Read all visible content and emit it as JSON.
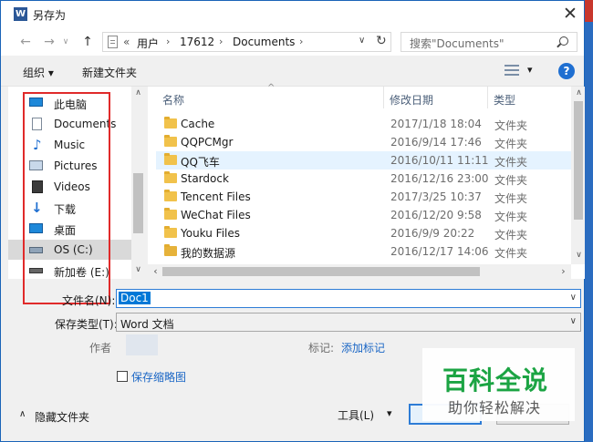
{
  "window": {
    "title": "另存为",
    "app_icon_letter": "W",
    "close_glyph": "✕"
  },
  "address": {
    "back_glyph": "←",
    "forward_glyph": "→",
    "up_glyph": "↑",
    "overflow": "«",
    "crumbs": [
      "用户",
      "17612",
      "Documents"
    ],
    "separator": "›",
    "dropdown_glyph": "∨",
    "refresh_glyph": "↻"
  },
  "search": {
    "placeholder": "搜索\"Documents\""
  },
  "toolbar": {
    "organize": "组织 ▾",
    "new_folder": "新建文件夹",
    "view_dropdown": "▾",
    "help": "?"
  },
  "nav": {
    "items": [
      {
        "label": "此电脑",
        "icon": "pc-icon"
      },
      {
        "label": "Documents",
        "icon": "documents-icon"
      },
      {
        "label": "Music",
        "icon": "music-icon"
      },
      {
        "label": "Pictures",
        "icon": "pictures-icon"
      },
      {
        "label": "Videos",
        "icon": "videos-icon"
      },
      {
        "label": "下载",
        "icon": "download-icon"
      },
      {
        "label": "桌面",
        "icon": "desktop-icon"
      },
      {
        "label": "OS (C:)",
        "icon": "drive-icon"
      },
      {
        "label": "新加卷 (E:)",
        "icon": "drive-icon"
      }
    ],
    "selected_index": 7
  },
  "files": {
    "columns": {
      "name": "名称",
      "modified": "修改日期",
      "type": "类型"
    },
    "rows": [
      {
        "name": "Cache",
        "modified": "2017/1/18 18:04",
        "type": "文件夹"
      },
      {
        "name": "QQPCMgr",
        "modified": "2016/9/14 17:46",
        "type": "文件夹"
      },
      {
        "name": "QQ飞车",
        "modified": "2016/10/11 11:11",
        "type": "文件夹"
      },
      {
        "name": "Stardock",
        "modified": "2016/12/16 23:00",
        "type": "文件夹"
      },
      {
        "name": "Tencent Files",
        "modified": "2017/3/25 10:37",
        "type": "文件夹"
      },
      {
        "name": "WeChat Files",
        "modified": "2016/12/20 9:58",
        "type": "文件夹"
      },
      {
        "name": "Youku Files",
        "modified": "2016/9/9 20:22",
        "type": "文件夹"
      },
      {
        "name": "我的数据源",
        "modified": "2016/12/17 14:06",
        "type": "文件夹"
      }
    ],
    "highlighted_index": 2
  },
  "form": {
    "filename_label": "文件名(N):",
    "filename_value": "Doc1",
    "filetype_label": "保存类型(T):",
    "filetype_value": "Word 文档",
    "author_label": "作者",
    "tags_label": "标记:",
    "tags_link": "添加标记",
    "thumbnail_label": "保存缩略图"
  },
  "footer": {
    "hide_folders": "隐藏文件夹",
    "tools": "工具(L)",
    "tools_dropdown": "▾"
  },
  "watermark": {
    "main": "百科全说",
    "sub": "助你轻松解决"
  }
}
